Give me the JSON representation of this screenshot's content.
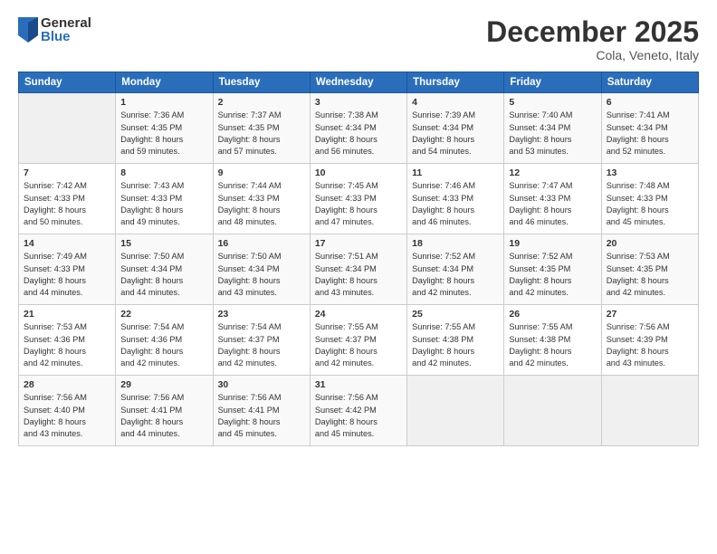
{
  "logo": {
    "general": "General",
    "blue": "Blue"
  },
  "title": "December 2025",
  "location": "Cola, Veneto, Italy",
  "days_header": [
    "Sunday",
    "Monday",
    "Tuesday",
    "Wednesday",
    "Thursday",
    "Friday",
    "Saturday"
  ],
  "weeks": [
    [
      {
        "day": "",
        "info": ""
      },
      {
        "day": "1",
        "info": "Sunrise: 7:36 AM\nSunset: 4:35 PM\nDaylight: 8 hours\nand 59 minutes."
      },
      {
        "day": "2",
        "info": "Sunrise: 7:37 AM\nSunset: 4:35 PM\nDaylight: 8 hours\nand 57 minutes."
      },
      {
        "day": "3",
        "info": "Sunrise: 7:38 AM\nSunset: 4:34 PM\nDaylight: 8 hours\nand 56 minutes."
      },
      {
        "day": "4",
        "info": "Sunrise: 7:39 AM\nSunset: 4:34 PM\nDaylight: 8 hours\nand 54 minutes."
      },
      {
        "day": "5",
        "info": "Sunrise: 7:40 AM\nSunset: 4:34 PM\nDaylight: 8 hours\nand 53 minutes."
      },
      {
        "day": "6",
        "info": "Sunrise: 7:41 AM\nSunset: 4:34 PM\nDaylight: 8 hours\nand 52 minutes."
      }
    ],
    [
      {
        "day": "7",
        "info": "Sunrise: 7:42 AM\nSunset: 4:33 PM\nDaylight: 8 hours\nand 50 minutes."
      },
      {
        "day": "8",
        "info": "Sunrise: 7:43 AM\nSunset: 4:33 PM\nDaylight: 8 hours\nand 49 minutes."
      },
      {
        "day": "9",
        "info": "Sunrise: 7:44 AM\nSunset: 4:33 PM\nDaylight: 8 hours\nand 48 minutes."
      },
      {
        "day": "10",
        "info": "Sunrise: 7:45 AM\nSunset: 4:33 PM\nDaylight: 8 hours\nand 47 minutes."
      },
      {
        "day": "11",
        "info": "Sunrise: 7:46 AM\nSunset: 4:33 PM\nDaylight: 8 hours\nand 46 minutes."
      },
      {
        "day": "12",
        "info": "Sunrise: 7:47 AM\nSunset: 4:33 PM\nDaylight: 8 hours\nand 46 minutes."
      },
      {
        "day": "13",
        "info": "Sunrise: 7:48 AM\nSunset: 4:33 PM\nDaylight: 8 hours\nand 45 minutes."
      }
    ],
    [
      {
        "day": "14",
        "info": "Sunrise: 7:49 AM\nSunset: 4:33 PM\nDaylight: 8 hours\nand 44 minutes."
      },
      {
        "day": "15",
        "info": "Sunrise: 7:50 AM\nSunset: 4:34 PM\nDaylight: 8 hours\nand 44 minutes."
      },
      {
        "day": "16",
        "info": "Sunrise: 7:50 AM\nSunset: 4:34 PM\nDaylight: 8 hours\nand 43 minutes."
      },
      {
        "day": "17",
        "info": "Sunrise: 7:51 AM\nSunset: 4:34 PM\nDaylight: 8 hours\nand 43 minutes."
      },
      {
        "day": "18",
        "info": "Sunrise: 7:52 AM\nSunset: 4:34 PM\nDaylight: 8 hours\nand 42 minutes."
      },
      {
        "day": "19",
        "info": "Sunrise: 7:52 AM\nSunset: 4:35 PM\nDaylight: 8 hours\nand 42 minutes."
      },
      {
        "day": "20",
        "info": "Sunrise: 7:53 AM\nSunset: 4:35 PM\nDaylight: 8 hours\nand 42 minutes."
      }
    ],
    [
      {
        "day": "21",
        "info": "Sunrise: 7:53 AM\nSunset: 4:36 PM\nDaylight: 8 hours\nand 42 minutes."
      },
      {
        "day": "22",
        "info": "Sunrise: 7:54 AM\nSunset: 4:36 PM\nDaylight: 8 hours\nand 42 minutes."
      },
      {
        "day": "23",
        "info": "Sunrise: 7:54 AM\nSunset: 4:37 PM\nDaylight: 8 hours\nand 42 minutes."
      },
      {
        "day": "24",
        "info": "Sunrise: 7:55 AM\nSunset: 4:37 PM\nDaylight: 8 hours\nand 42 minutes."
      },
      {
        "day": "25",
        "info": "Sunrise: 7:55 AM\nSunset: 4:38 PM\nDaylight: 8 hours\nand 42 minutes."
      },
      {
        "day": "26",
        "info": "Sunrise: 7:55 AM\nSunset: 4:38 PM\nDaylight: 8 hours\nand 42 minutes."
      },
      {
        "day": "27",
        "info": "Sunrise: 7:56 AM\nSunset: 4:39 PM\nDaylight: 8 hours\nand 43 minutes."
      }
    ],
    [
      {
        "day": "28",
        "info": "Sunrise: 7:56 AM\nSunset: 4:40 PM\nDaylight: 8 hours\nand 43 minutes."
      },
      {
        "day": "29",
        "info": "Sunrise: 7:56 AM\nSunset: 4:41 PM\nDaylight: 8 hours\nand 44 minutes."
      },
      {
        "day": "30",
        "info": "Sunrise: 7:56 AM\nSunset: 4:41 PM\nDaylight: 8 hours\nand 45 minutes."
      },
      {
        "day": "31",
        "info": "Sunrise: 7:56 AM\nSunset: 4:42 PM\nDaylight: 8 hours\nand 45 minutes."
      },
      {
        "day": "",
        "info": ""
      },
      {
        "day": "",
        "info": ""
      },
      {
        "day": "",
        "info": ""
      }
    ]
  ]
}
